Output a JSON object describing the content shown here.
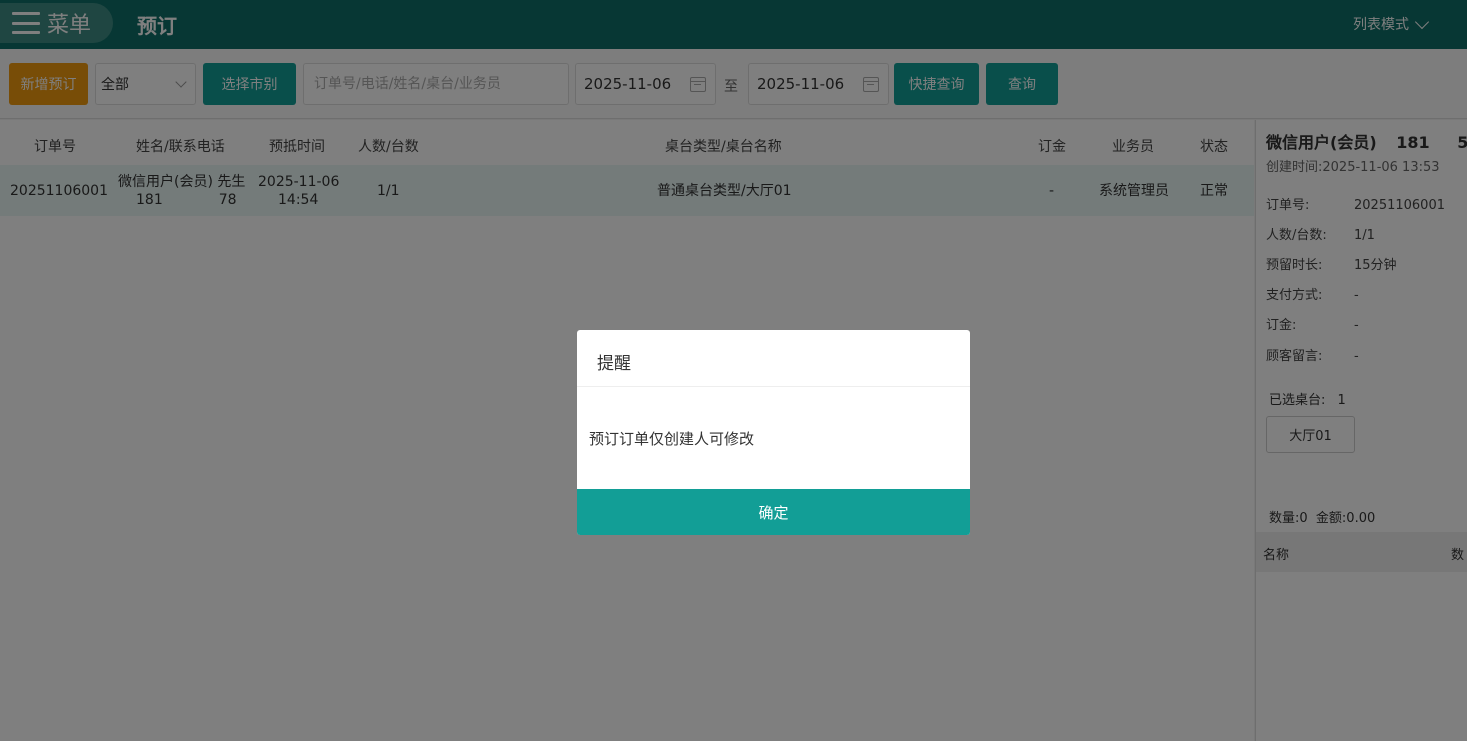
{
  "header": {
    "menu_label": "菜单",
    "title": "预订",
    "view_mode": "列表模式"
  },
  "toolbar": {
    "new_label": "新增预订",
    "filter_value": "全部",
    "market_label": "选择市别",
    "search_placeholder": "订单号/电话/姓名/桌台/业务员",
    "date_from": "2025-11-06",
    "to_label": "至",
    "date_to": "2025-11-06",
    "quick_label": "快捷查询",
    "query_label": "查询"
  },
  "table": {
    "columns": [
      "订单号",
      "姓名/联系电话",
      "预抵时间",
      "人数/台数",
      "桌台类型/桌台名称",
      "订金",
      "业务员",
      "状态"
    ],
    "rows": [
      {
        "order_no": "20251106001",
        "name": "微信用户(会员) 先生",
        "phone": "181　　　　78",
        "arrival_date": "2025-11-06",
        "arrival_time": "14:54",
        "guests": "1/1",
        "table_type": "普通桌台类型/大厅01",
        "deposit": "-",
        "staff": "系统管理员",
        "status": "正常"
      }
    ]
  },
  "panel": {
    "name": "微信用户(会员)",
    "phone_prefix": "181",
    "phone_tail": "5",
    "created": "创建时间:2025-11-06 13:53",
    "details": [
      {
        "label": "订单号:",
        "value": "20251106001"
      },
      {
        "label": "人数/台数:",
        "value": "1/1"
      },
      {
        "label": "预留时长:",
        "value": "15分钟"
      },
      {
        "label": "支付方式:",
        "value": "-"
      },
      {
        "label": "订金:",
        "value": "-"
      },
      {
        "label": "顾客留言:",
        "value": "-"
      }
    ],
    "selected_label": "已选桌台:",
    "selected_count": "1",
    "table_tag": "大厅01",
    "summary": "数量:0  金额:0.00",
    "list_head_name": "名称",
    "list_head_qty": "数"
  },
  "modal": {
    "title": "提醒",
    "message": "预订订单仅创建人可修改",
    "ok_label": "确定"
  }
}
